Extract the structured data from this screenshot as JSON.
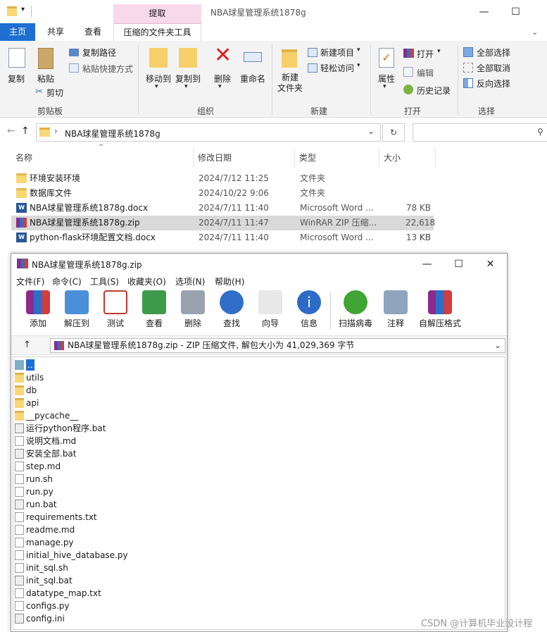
{
  "explorer": {
    "title": "NBA球星管理系统1878g",
    "context_tab": "提取",
    "tabs": [
      "主页",
      "共享",
      "查看",
      "压缩的文件夹工具"
    ],
    "ribbon": {
      "clipboard": {
        "copy": "复制",
        "paste": "粘贴",
        "copy_path": "复制路径",
        "paste_shortcut": "粘贴快捷方式",
        "cut": "剪切",
        "group": "剪贴板"
      },
      "organize": {
        "move_to": "移动到",
        "copy_to": "复制到",
        "delete": "删除",
        "rename": "重命名",
        "group": "组织"
      },
      "new": {
        "new_folder": "新建\n文件夹",
        "new_item": "新建项目",
        "easy_access": "轻松访问",
        "group": "新建"
      },
      "open": {
        "properties": "属性",
        "open": "打开",
        "edit": "编辑",
        "history": "历史记录",
        "group": "打开"
      },
      "select": {
        "select_all": "全部选择",
        "select_none": "全部取消",
        "invert": "反向选择",
        "group": "选择"
      }
    },
    "address": "NBA球星管理系统1878g",
    "columns": [
      "名称",
      "修改日期",
      "类型",
      "大小"
    ],
    "files": [
      {
        "name": "环境安装环境",
        "date": "2024/7/12 11:25",
        "type": "文件夹",
        "size": "",
        "kind": "folder"
      },
      {
        "name": "数据库文件",
        "date": "2024/10/22 9:06",
        "type": "文件夹",
        "size": "",
        "kind": "folder"
      },
      {
        "name": "NBA球星管理系统1878g.docx",
        "date": "2024/7/11 11:40",
        "type": "Microsoft Word ...",
        "size": "78 KB",
        "kind": "word"
      },
      {
        "name": "NBA球星管理系统1878g.zip",
        "date": "2024/7/11 11:47",
        "type": "WinRAR ZIP 压缩...",
        "size": "22,618 KB",
        "kind": "rar"
      },
      {
        "name": "python-flask环境配置文档.docx",
        "date": "2024/7/11 11:40",
        "type": "Microsoft Word ...",
        "size": "13 KB",
        "kind": "word"
      }
    ]
  },
  "winrar": {
    "title": "NBA球星管理系统1878g.zip",
    "menu": [
      "文件(F)",
      "命令(C)",
      "工具(S)",
      "收藏夹(O)",
      "选项(N)",
      "帮助(H)"
    ],
    "toolbar": [
      "添加",
      "解压到",
      "测试",
      "查看",
      "删除",
      "查找",
      "向导",
      "信息",
      "扫描病毒",
      "注释",
      "自解压格式"
    ],
    "path": "NBA球星管理系统1878g.zip - ZIP 压缩文件, 解包大小为 41,029,369 字节",
    "items": [
      {
        "name": "..",
        "kind": "up"
      },
      {
        "name": "utils",
        "kind": "folder"
      },
      {
        "name": "db",
        "kind": "folder"
      },
      {
        "name": "api",
        "kind": "folder"
      },
      {
        "name": "__pycache__",
        "kind": "folder"
      },
      {
        "name": "运行python程序.bat",
        "kind": "bat"
      },
      {
        "name": "说明文档.md",
        "kind": "doc"
      },
      {
        "name": "安装全部.bat",
        "kind": "bat"
      },
      {
        "name": "step.md",
        "kind": "doc"
      },
      {
        "name": "run.sh",
        "kind": "doc"
      },
      {
        "name": "run.py",
        "kind": "doc"
      },
      {
        "name": "run.bat",
        "kind": "bat"
      },
      {
        "name": "requirements.txt",
        "kind": "doc"
      },
      {
        "name": "readme.md",
        "kind": "doc"
      },
      {
        "name": "manage.py",
        "kind": "doc"
      },
      {
        "name": "initial_hive_database.py",
        "kind": "doc"
      },
      {
        "name": "init_sql.sh",
        "kind": "doc"
      },
      {
        "name": "init_sql.bat",
        "kind": "bat"
      },
      {
        "name": "datatype_map.txt",
        "kind": "doc"
      },
      {
        "name": "configs.py",
        "kind": "doc"
      },
      {
        "name": "config.ini",
        "kind": "bat"
      }
    ]
  },
  "watermark": "CSDN @计算机毕业设计程"
}
